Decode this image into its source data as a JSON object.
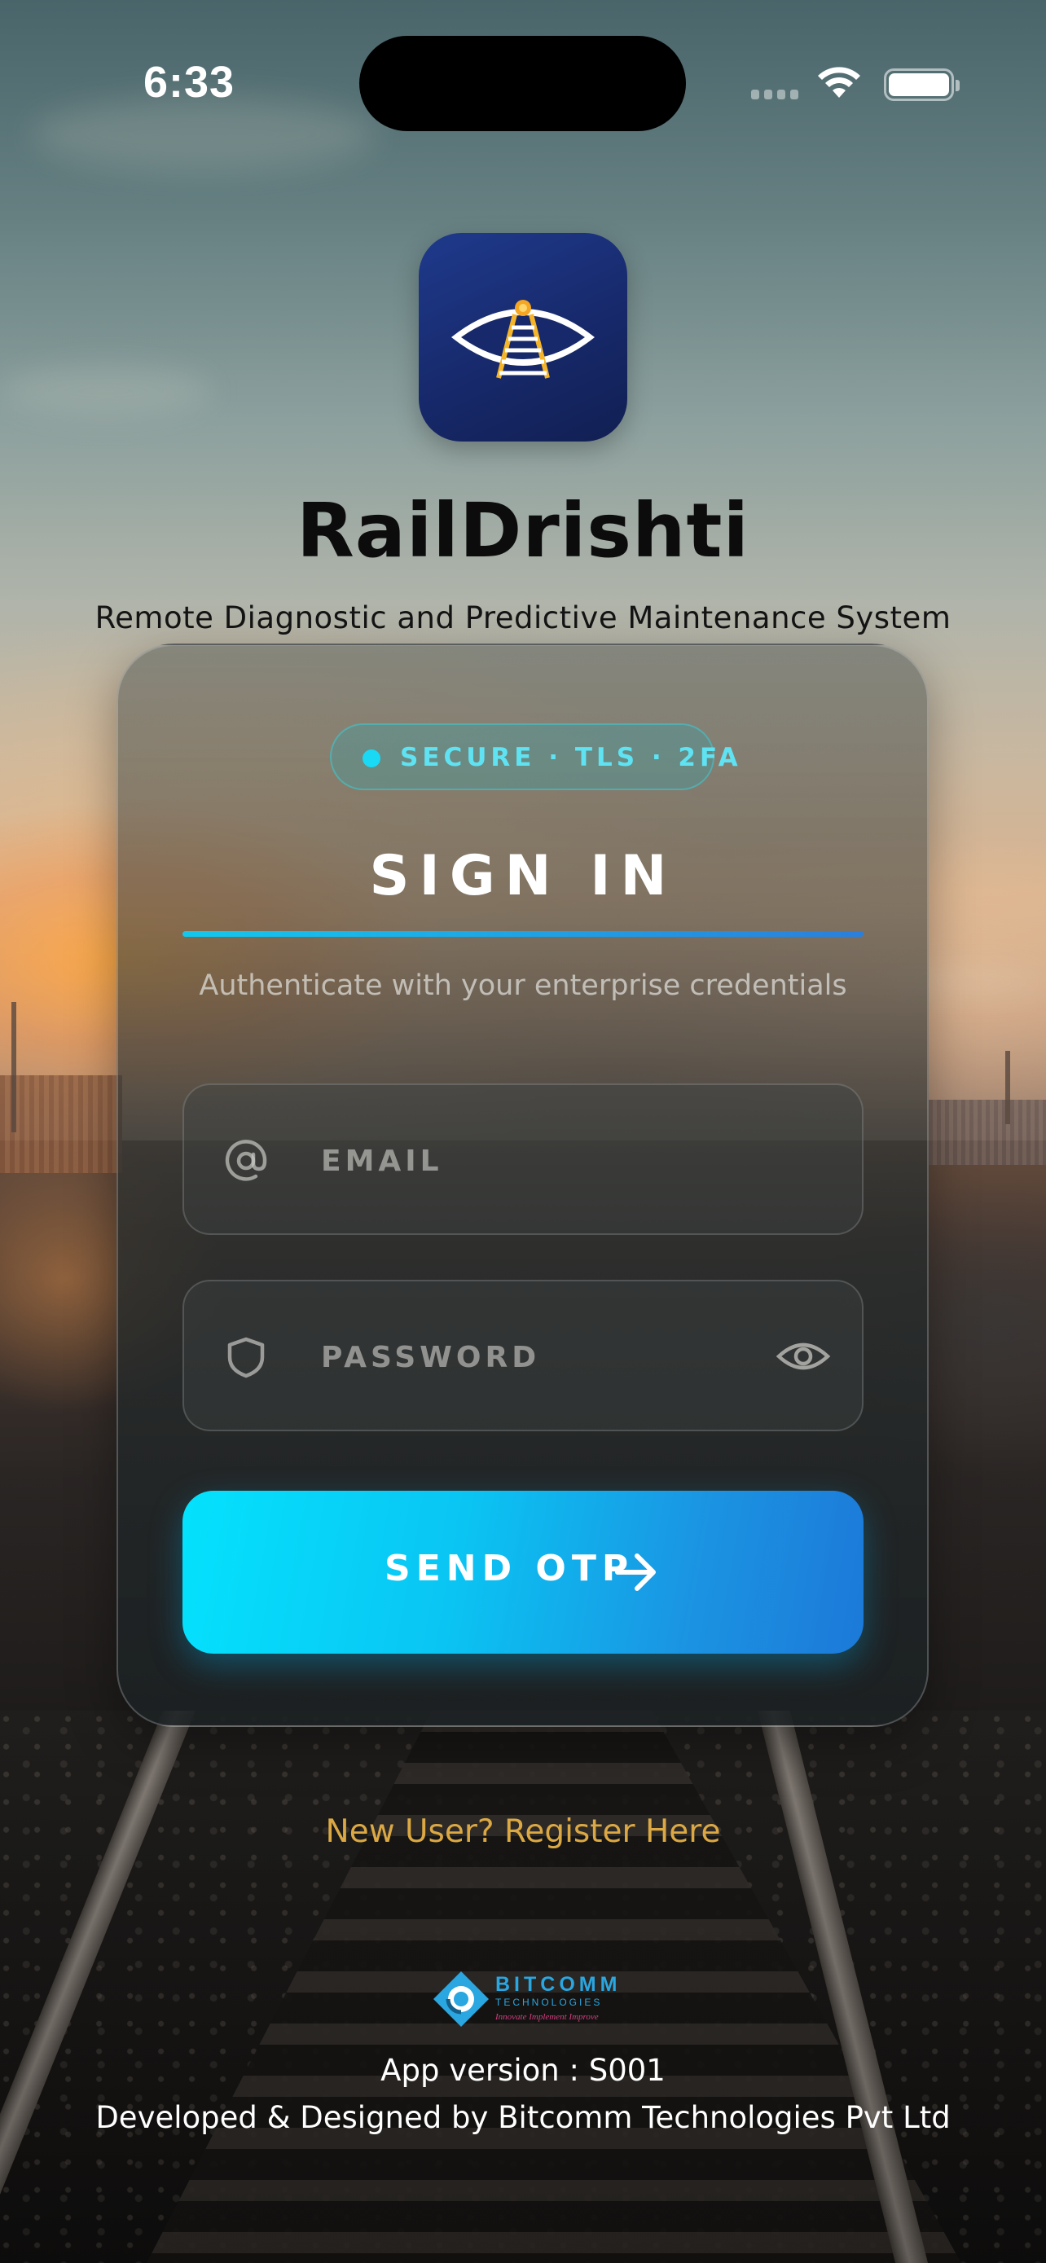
{
  "status_bar": {
    "time": "6:33"
  },
  "header": {
    "app_logo_icon": "eye-railway-track-icon",
    "title": "RailDrishti",
    "subtitle": "Remote Diagnostic and Predictive Maintenance System"
  },
  "login_card": {
    "badge": "SECURE · TLS · 2FA",
    "title": "SIGN IN",
    "hint": "Authenticate with your enterprise credentials",
    "email": {
      "placeholder": "EMAIL",
      "value": "",
      "icon": "at-icon"
    },
    "password": {
      "placeholder": "PASSWORD",
      "value": "",
      "icon": "shield-icon",
      "toggle_icon": "eye-icon"
    },
    "submit": {
      "label": "SEND OTP",
      "icon": "arrow-right-icon"
    }
  },
  "footer": {
    "register_link": "New User? Register Here",
    "company_logo": {
      "name": "BITCOMM",
      "sub": "TECHNOLOGIES",
      "tagline": "Innovate Implement Improve"
    },
    "app_version": "App version : S001",
    "developer_credit": "Developed & Designed by Bitcomm Technologies Pvt Ltd"
  },
  "colors": {
    "accent_cyan": "#04e2fd",
    "accent_blue": "#1c79d8",
    "register_link": "#dba844",
    "logo_navy": "#1f3a8c",
    "badge_text": "#5fe3f3"
  }
}
